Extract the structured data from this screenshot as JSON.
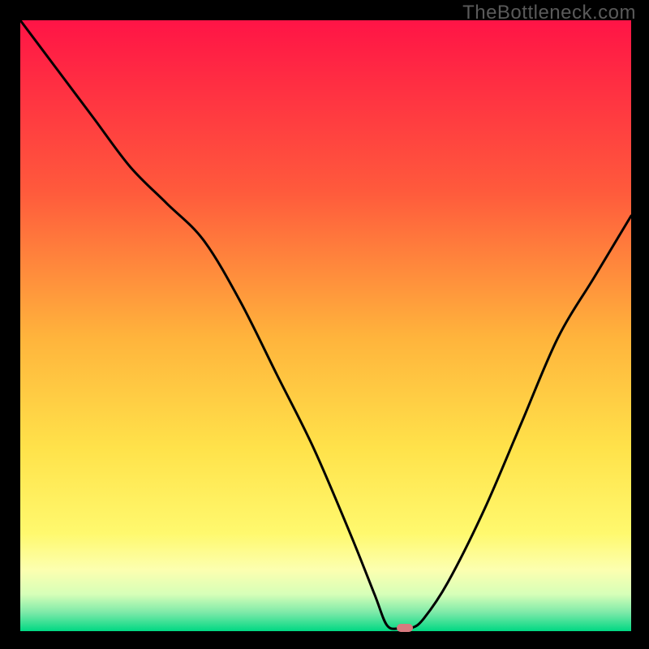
{
  "watermark": "TheBottleneck.com",
  "chart_data": {
    "type": "line",
    "title": "",
    "xlabel": "",
    "ylabel": "",
    "xlim": [
      0,
      100
    ],
    "ylim": [
      0,
      100
    ],
    "gradient_stops": [
      {
        "offset": 0,
        "color": "#ff1446"
      },
      {
        "offset": 28,
        "color": "#ff5a3c"
      },
      {
        "offset": 52,
        "color": "#ffb43c"
      },
      {
        "offset": 70,
        "color": "#ffe24a"
      },
      {
        "offset": 84,
        "color": "#fff96e"
      },
      {
        "offset": 90,
        "color": "#fcffb0"
      },
      {
        "offset": 94,
        "color": "#d6ffb8"
      },
      {
        "offset": 97,
        "color": "#7be9a8"
      },
      {
        "offset": 100,
        "color": "#00d883"
      }
    ],
    "series": [
      {
        "name": "bottleneck-curve",
        "x": [
          0,
          6,
          12,
          18,
          24,
          30,
          36,
          42,
          48,
          54,
          58,
          60,
          62,
          64,
          66,
          70,
          76,
          82,
          88,
          94,
          100
        ],
        "y": [
          100,
          92,
          84,
          76,
          70,
          64,
          54,
          42,
          30,
          16,
          6,
          1,
          0.4,
          0.5,
          2,
          8,
          20,
          34,
          48,
          58,
          68
        ]
      }
    ],
    "marker": {
      "x": 63,
      "y": 0.5,
      "color": "#d87a7f"
    }
  }
}
